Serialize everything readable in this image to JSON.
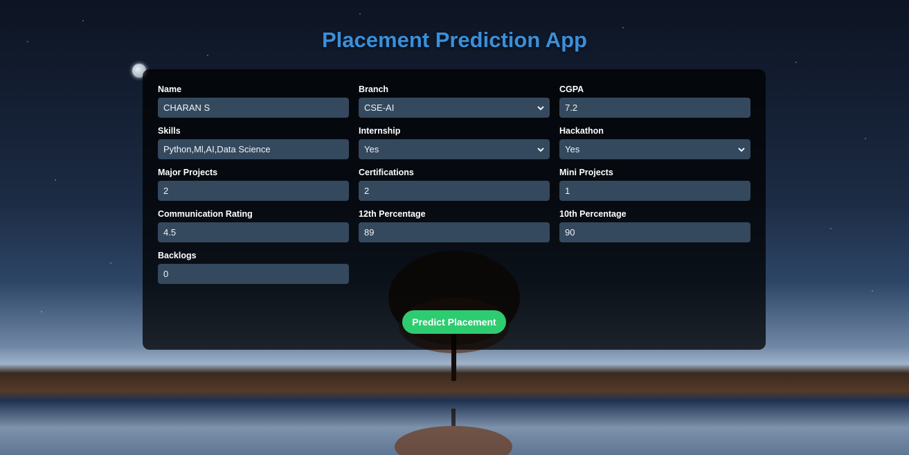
{
  "page": {
    "title": "Placement Prediction App"
  },
  "form": {
    "fields": [
      {
        "label": "Name",
        "type": "input",
        "value": "CHARAN S"
      },
      {
        "label": "Branch",
        "type": "select",
        "value": "CSE-AI"
      },
      {
        "label": "CGPA",
        "type": "input",
        "value": "7.2"
      },
      {
        "label": "Skills",
        "type": "input",
        "value": "Python,Ml,AI,Data Science"
      },
      {
        "label": "Internship",
        "type": "select",
        "value": "Yes"
      },
      {
        "label": "Hackathon",
        "type": "select",
        "value": "Yes"
      },
      {
        "label": "Major Projects",
        "type": "input",
        "value": "2"
      },
      {
        "label": "Certifications",
        "type": "input",
        "value": "2"
      },
      {
        "label": "Mini Projects",
        "type": "input",
        "value": "1"
      },
      {
        "label": "Communication Rating",
        "type": "input",
        "value": "4.5"
      },
      {
        "label": "12th Percentage",
        "type": "input",
        "value": "89"
      },
      {
        "label": "10th Percentage",
        "type": "input",
        "value": "90"
      },
      {
        "label": "Backlogs",
        "type": "input",
        "value": "0"
      }
    ],
    "submit_label": "Predict Placement"
  },
  "colors": {
    "title": "#3a8fd9",
    "field_bg": "#34495e",
    "button": "#2ecc71"
  }
}
